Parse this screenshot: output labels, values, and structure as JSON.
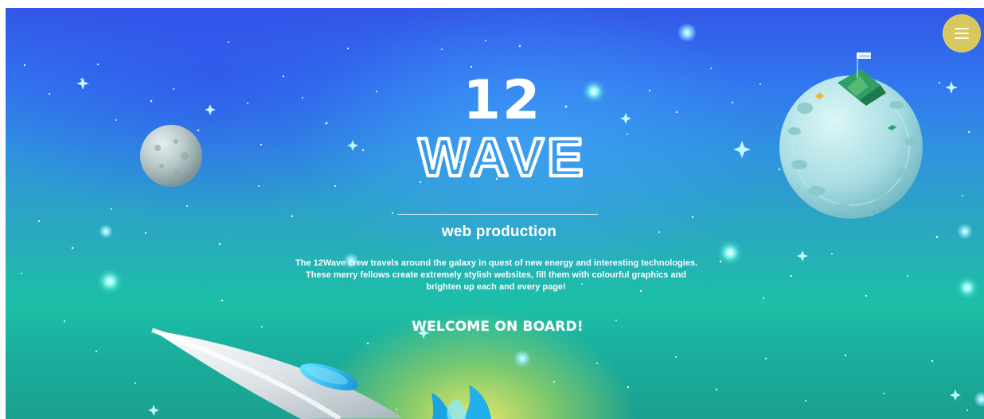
{
  "header": {
    "menu_icon": "hamburger-menu-icon",
    "menu_button_color": "#d8c85e"
  },
  "hero": {
    "brand_number": "12",
    "brand_word": "WAVE",
    "subtitle": "web production",
    "description_lines": [
      "The 12Wave crew travels around the galaxy in quest of new energy and interesting technologies.",
      "These merry fellows create extremely stylish websites, fill them with colourful graphics and",
      "brighten up each and every page!"
    ],
    "cta": "WELCOME ON BOARD!"
  },
  "scene": {
    "sign_text": "12Wave",
    "colors": {
      "sky_blue": "#3276ef",
      "teal": "#1cc0a7",
      "glow_yellow": "#f5ec67",
      "planet_cyan": "#9ed7dd",
      "tent_green": "#2f9f63",
      "rocket_blue": "#21a9e4"
    }
  }
}
